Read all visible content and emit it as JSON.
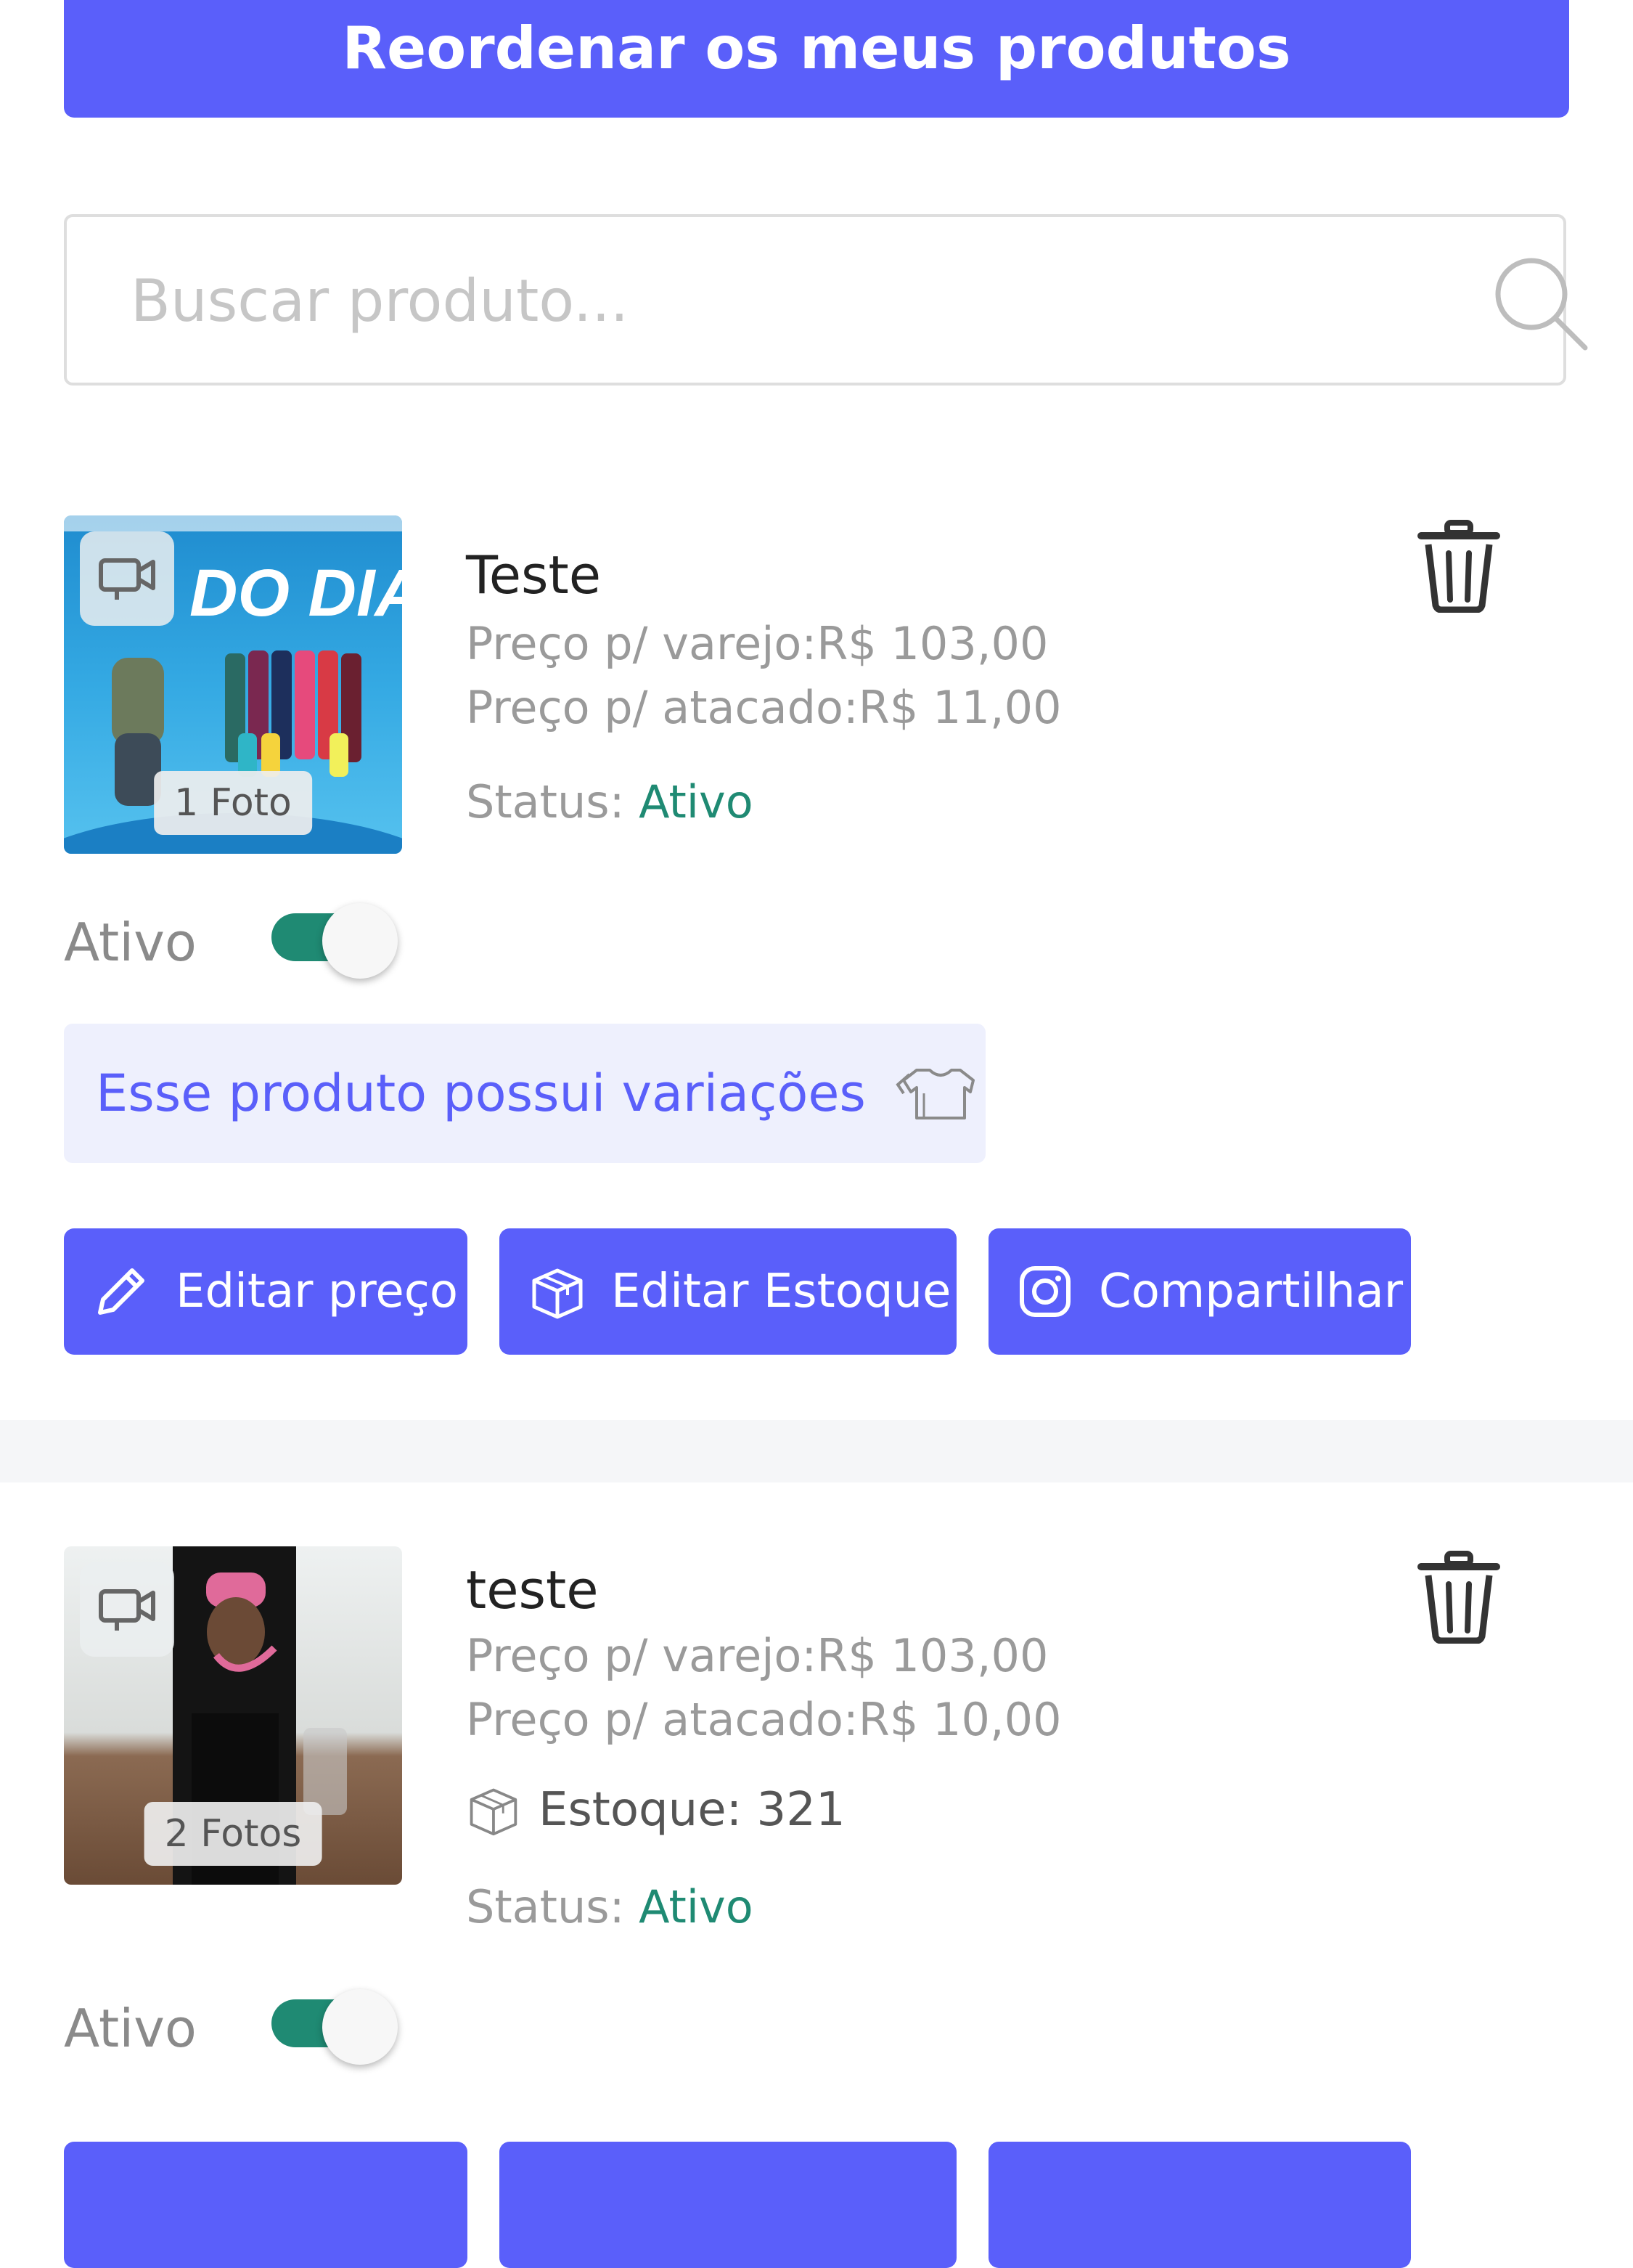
{
  "header": {
    "reorder_label": "Reordenar os meus produtos"
  },
  "search": {
    "placeholder": "Buscar produto...",
    "value": ""
  },
  "colors": {
    "primary": "#5a5ffa",
    "active_green": "#1f8a73",
    "variations_bg": "#eef0fd"
  },
  "products": [
    {
      "name": "Teste",
      "retail_price": "Preço p/ varejo:R$ 103,00",
      "wholesale_price": "Preço p/ atacado:R$ 11,00",
      "status_label": "Status:",
      "status_value": "Ativo",
      "photo_count": "1 Foto",
      "image_text": "DO DIA!",
      "active_toggle_label": "Ativo",
      "active": true,
      "variations_text": "Esse produto possui variações",
      "actions": {
        "edit_price": "Editar preço",
        "edit_stock": "Editar Estoque",
        "share": "Compartilhar"
      }
    },
    {
      "name": "teste",
      "retail_price": "Preço p/ varejo:R$ 103,00",
      "wholesale_price": "Preço p/ atacado:R$ 10,00",
      "stock": "Estoque: 321",
      "status_label": "Status:",
      "status_value": "Ativo",
      "photo_count": "2 Fotos",
      "active_toggle_label": "Ativo",
      "active": true
    }
  ],
  "icons": [
    "video-icon",
    "trash-icon",
    "search-icon",
    "tshirt-icon",
    "pencil-icon",
    "box-icon",
    "instagram-icon"
  ]
}
